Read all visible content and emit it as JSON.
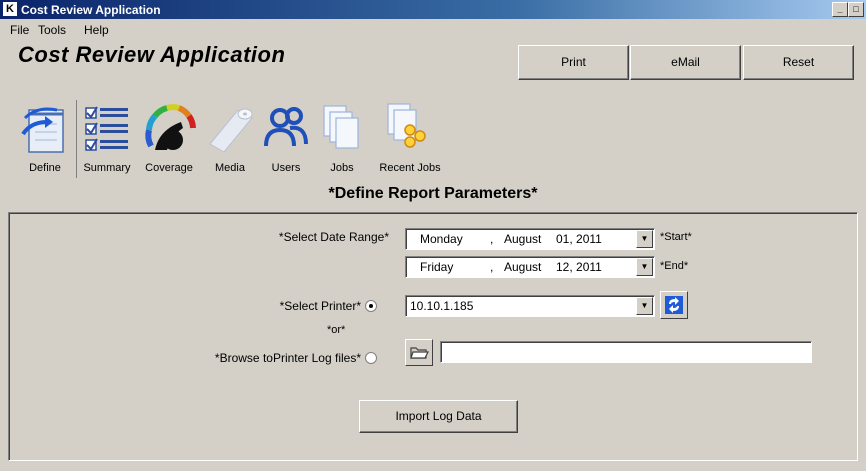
{
  "window": {
    "app_icon": "K",
    "title": "Cost Review Application",
    "controls": [
      "minimize-icon",
      "maximize-icon",
      "close-icon"
    ]
  },
  "menu": [
    "File",
    "Tools",
    "Help"
  ],
  "header": {
    "title": "Cost Review Application",
    "buttons": [
      "Print",
      "eMail",
      "Reset"
    ]
  },
  "toolbar": [
    {
      "label": "Define",
      "icon": "calendar-icon"
    },
    {
      "label": "Summary",
      "icon": "checklist-icon"
    },
    {
      "label": "Coverage",
      "icon": "color-wheel-icon"
    },
    {
      "label": "Media",
      "icon": "paper-roll-icon"
    },
    {
      "label": "Users",
      "icon": "users-icon"
    },
    {
      "label": "Jobs",
      "icon": "documents-icon"
    },
    {
      "label": "Recent Jobs",
      "icon": "recent-jobs-icon"
    }
  ],
  "page_heading": "*Define Report Parameters*",
  "form": {
    "date_range_label": "*Select Date Range*",
    "start": {
      "day": "Monday",
      "sep": ",",
      "month": "August",
      "date": "01, 2011",
      "tag": "*Start*"
    },
    "end": {
      "day": "Friday",
      "sep": ",",
      "month": "August",
      "date": "12, 2011",
      "tag": "*End*"
    },
    "printer_label": "*Select Printer*",
    "printer_value": "10.10.1.185",
    "or_label": "*or*",
    "browse_label": "*Browse toPrinter Log files*",
    "browse_value": "",
    "import_button": "Import Log Data"
  },
  "colors": {
    "window_bg": "#d4d0c8",
    "titlebar_start": "#0a246a",
    "titlebar_end": "#a6caf0",
    "refresh_icon_blue": "#1f5bd6"
  }
}
